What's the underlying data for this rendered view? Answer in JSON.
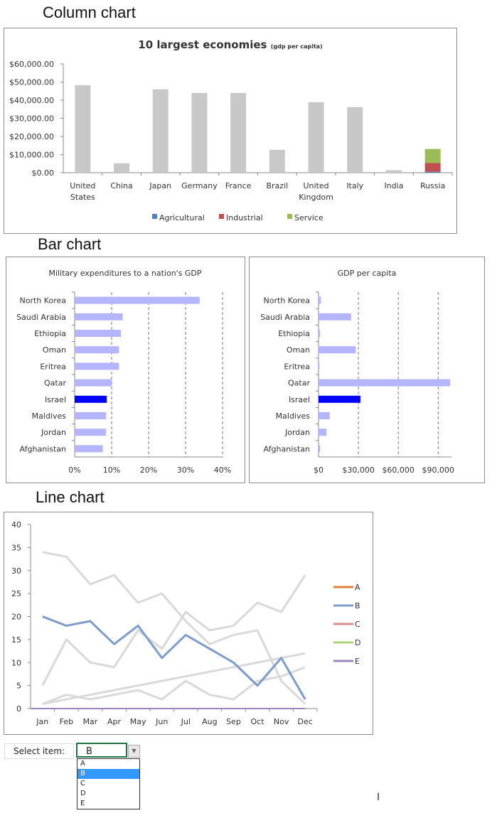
{
  "sections": {
    "column": "Column chart",
    "bar": "Bar chart",
    "line": "Line chart"
  },
  "column_chart": {
    "title": "10 largest economies",
    "subtitle": "(gdp per capita)",
    "legend": [
      "Agricultural",
      "Industrial",
      "Service"
    ]
  },
  "selector": {
    "label": "Select item:",
    "value": "B",
    "options": [
      "A",
      "B",
      "C",
      "D",
      "E"
    ],
    "highlighted": "B"
  },
  "colors": {
    "gray_bar": "#c8c8c8",
    "agricultural": "#4f81bd",
    "industrial": "#c0504d",
    "service": "#9bbb59",
    "light_bar": "#b4b4ff",
    "highlight_bar": "#0000ff",
    "gray_line": "#d9d9d9",
    "A": "#e0823c",
    "B": "#7f9bc8",
    "C": "#d98c8c",
    "D": "#a9cf7f",
    "E": "#9b86b8"
  },
  "chart_data": [
    {
      "type": "bar",
      "title": "10 largest economies (gdp per capita)",
      "categories": [
        "United States",
        "China",
        "Japan",
        "Germany",
        "France",
        "Brazil",
        "United Kingdom",
        "Italy",
        "India",
        "Russia"
      ],
      "values": [
        48300,
        5200,
        46000,
        44000,
        44000,
        12600,
        38900,
        36200,
        1400,
        null
      ],
      "stacked": {
        "category": "Russia",
        "series": [
          {
            "name": "Agricultural",
            "value": 500
          },
          {
            "name": "Industrial",
            "value": 4800
          },
          {
            "name": "Service",
            "value": 7800
          }
        ]
      },
      "ylim": [
        0,
        60000
      ],
      "yticks": [
        "$0.00",
        "$10,000.00",
        "$20,000.00",
        "$30,000.00",
        "$40,000.00",
        "$50,000.00",
        "$60,000.00"
      ],
      "legend": "bottom",
      "grid": false
    },
    {
      "type": "bar",
      "orientation": "horizontal",
      "title": "Military expenditures to a nation's GDP",
      "categories": [
        "North Korea",
        "Saudi Arabia",
        "Ethiopia",
        "Oman",
        "Eritrea",
        "Qatar",
        "Israel",
        "Maldives",
        "Jordan",
        "Afghanistan"
      ],
      "values": [
        33.8,
        13,
        12.5,
        12,
        12,
        10,
        8.7,
        8.5,
        8.5,
        7.6
      ],
      "highlight": "Israel",
      "xlim": [
        0,
        40
      ],
      "xticks": [
        "0%",
        "10%",
        "20%",
        "30%",
        "40%"
      ],
      "grid": "dashed vertical"
    },
    {
      "type": "bar",
      "orientation": "horizontal",
      "title": "GDP per capita",
      "categories": [
        "North Korea",
        "Saudi Arabia",
        "Ethiopia",
        "Oman",
        "Eritrea",
        "Qatar",
        "Israel",
        "Maldives",
        "Jordan",
        "Afghanistan"
      ],
      "values": [
        1800,
        24500,
        1200,
        28000,
        700,
        99000,
        31500,
        8500,
        6000,
        1200
      ],
      "highlight": "Israel",
      "xlim": [
        0,
        100000
      ],
      "xticks": [
        "$0",
        "$30,000",
        "$60,000",
        "$90,000"
      ],
      "tickvalues": [
        0,
        30000,
        60000,
        90000
      ],
      "grid": "dashed vertical"
    },
    {
      "type": "line",
      "x": [
        "Jan",
        "Feb",
        "Mar",
        "Apr",
        "May",
        "Jun",
        "Jul",
        "Aug",
        "Sep",
        "Oct",
        "Nov",
        "Dec"
      ],
      "ylim": [
        0,
        40
      ],
      "yticks": [
        0,
        5,
        10,
        15,
        20,
        25,
        30,
        35,
        40
      ],
      "selected": "B",
      "legend": "right",
      "series": [
        {
          "name": "A",
          "values": [
            34,
            33,
            27,
            29,
            23,
            25,
            19,
            14,
            16,
            17,
            6,
            1
          ]
        },
        {
          "name": "B",
          "values": [
            20,
            18,
            19,
            14,
            18,
            11,
            16,
            13,
            10,
            5,
            11,
            2
          ]
        },
        {
          "name": "C",
          "values": [
            5,
            15,
            10,
            9,
            17,
            13,
            21,
            17,
            18,
            23,
            21,
            29
          ]
        },
        {
          "name": "D",
          "values": [
            1,
            2,
            3,
            4,
            5,
            6,
            7,
            8,
            9,
            10,
            11,
            12
          ]
        },
        {
          "name": "E",
          "values": [
            1,
            3,
            2,
            3,
            4,
            2,
            6,
            3,
            2,
            6,
            7,
            9
          ]
        }
      ]
    }
  ]
}
